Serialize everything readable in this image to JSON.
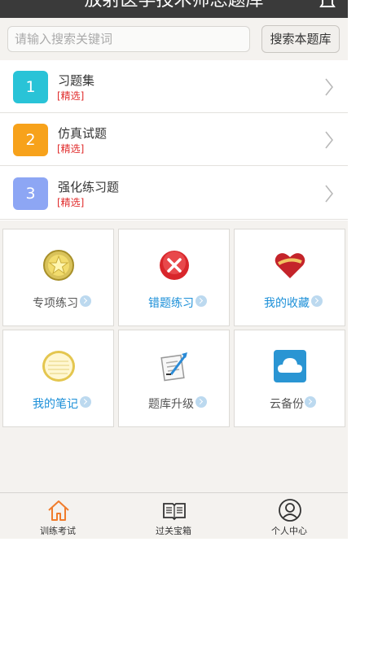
{
  "header": {
    "title": "放射医学技术师总题库"
  },
  "search": {
    "placeholder": "请输入搜索关键词",
    "button_label": "搜索本题库"
  },
  "list": [
    {
      "num": "1",
      "title": "习题集",
      "tag": "[精选]",
      "color": "#29c3d7"
    },
    {
      "num": "2",
      "title": "仿真试题",
      "tag": "[精选]",
      "color": "#f7a21b"
    },
    {
      "num": "3",
      "title": "强化练习题",
      "tag": "[精选]",
      "color": "#8da6f4"
    }
  ],
  "grid": [
    {
      "label": "专项练习",
      "icon": "star-badge-icon",
      "label_color": "#555555"
    },
    {
      "label": "错题练习",
      "icon": "red-x-icon",
      "label_color": "#1b8fd8"
    },
    {
      "label": "我的收藏",
      "icon": "heart-icon",
      "label_color": "#1b8fd8"
    },
    {
      "label": "我的笔记",
      "icon": "notepad-icon",
      "label_color": "#1b8fd8"
    },
    {
      "label": "题库升级",
      "icon": "document-arrow-icon",
      "label_color": "#555555"
    },
    {
      "label": "云备份",
      "icon": "cloud-icon",
      "label_color": "#555555"
    }
  ],
  "bottom_nav": [
    {
      "label": "训练考试",
      "icon": "home-icon"
    },
    {
      "label": "过关宝箱",
      "icon": "book-icon"
    },
    {
      "label": "个人中心",
      "icon": "user-icon"
    }
  ],
  "colors": {
    "active_nav": "#f07c2c",
    "chevron": "#b8b8b8",
    "tag": "#e02a2a"
  }
}
